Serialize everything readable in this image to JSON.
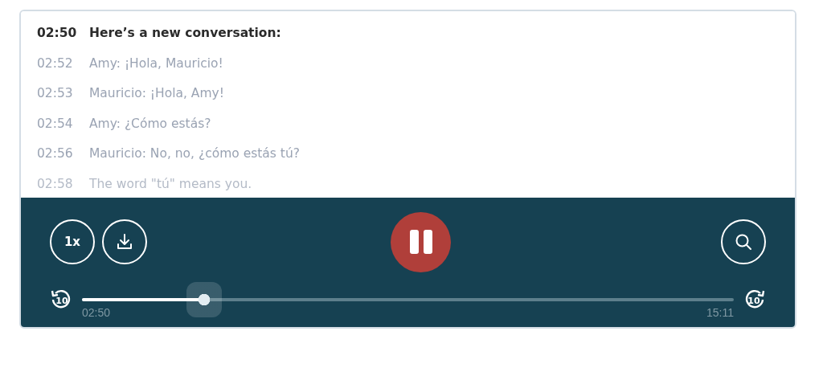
{
  "transcript": [
    {
      "time": "02:50",
      "text": "Here’s a new conversation:",
      "current": true
    },
    {
      "time": "02:52",
      "text": "Amy: ¡Hola, Mauricio!",
      "current": false
    },
    {
      "time": "02:53",
      "text": "Mauricio: ¡Hola, Amy!",
      "current": false
    },
    {
      "time": "02:54",
      "text": "Amy: ¿Cómo estás?",
      "current": false
    },
    {
      "time": "02:56",
      "text": "Mauricio: No, no, ¿cómo estás tú?",
      "current": false
    },
    {
      "time": "02:58",
      "text": "The word \"tú\" means you.",
      "current": false
    }
  ],
  "player": {
    "speed": "1x",
    "playing": true,
    "skip_back": "10",
    "skip_forward": "10",
    "progress": {
      "level": 0.187,
      "elapsed": "02:50",
      "duration": "15:11"
    }
  }
}
